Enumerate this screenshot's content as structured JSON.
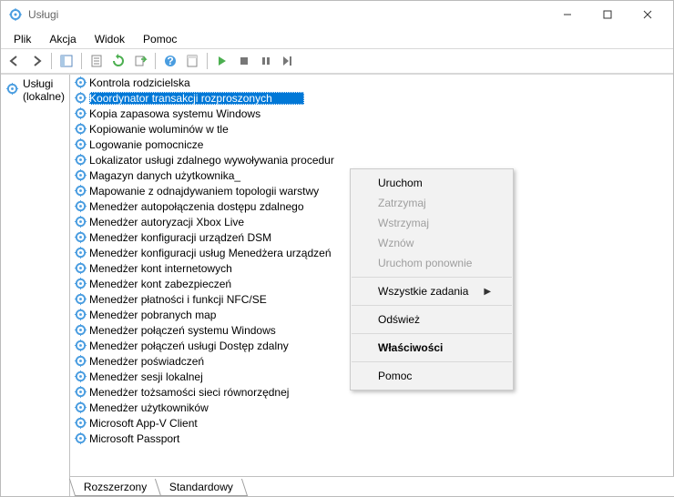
{
  "window": {
    "title": "Usługi"
  },
  "menu": {
    "file": "Plik",
    "action": "Akcja",
    "view": "Widok",
    "help": "Pomoc"
  },
  "sidebar": {
    "root": "Usługi (lokalne)"
  },
  "services": [
    "Kontrola rodzicielska",
    "Koordynator transakcji rozproszonych",
    "Kopia zapasowa systemu Windows",
    "Kopiowanie woluminów w tle",
    "Logowanie pomocnicze",
    "Lokalizator usługi zdalnego wywoływania procedur",
    "Magazyn danych użytkownika_",
    "Mapowanie z odnajdywaniem topologii warstwy",
    "Menedżer autopołączenia dostępu zdalnego",
    "Menedżer autoryzacji Xbox Live",
    "Menedżer konfiguracji urządzeń DSM",
    "Menedżer konfiguracji usług Menedżera urządzeń",
    "Menedżer kont internetowych",
    "Menedżer kont zabezpieczeń",
    "Menedżer płatności i funkcji NFC/SE",
    "Menedżer pobranych map",
    "Menedżer połączeń systemu Windows",
    "Menedżer połączeń usługi Dostęp zdalny",
    "Menedżer poświadczeń",
    "Menedżer sesji lokalnej",
    "Menedżer tożsamości sieci równorzędnej",
    "Menedżer użytkowników",
    "Microsoft App-V Client",
    "Microsoft Passport"
  ],
  "selected_index": 1,
  "context_menu": {
    "start": "Uruchom",
    "stop": "Zatrzymaj",
    "pause": "Wstrzymaj",
    "resume": "Wznów",
    "restart": "Uruchom ponownie",
    "all_tasks": "Wszystkie zadania",
    "refresh": "Odśwież",
    "properties": "Właściwości",
    "help": "Pomoc"
  },
  "tabs": {
    "extended": "Rozszerzony",
    "standard": "Standardowy"
  }
}
